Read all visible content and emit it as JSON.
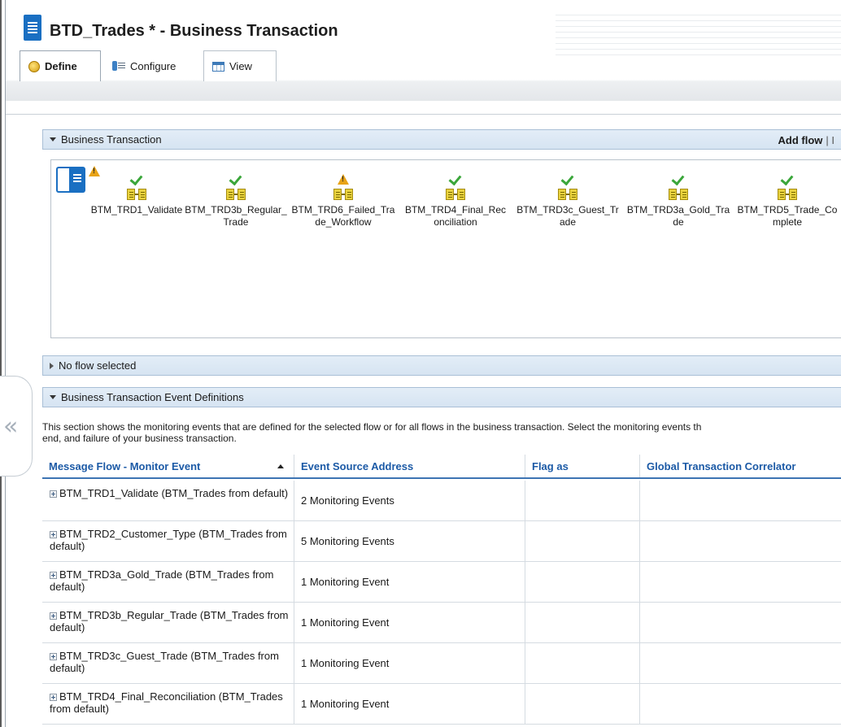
{
  "window": {
    "title": "BTD_Trades * - Business Transaction"
  },
  "tabs": [
    {
      "label": "Define",
      "icon": "define-icon",
      "active": true
    },
    {
      "label": "Configure",
      "icon": "configure-icon",
      "active": false
    },
    {
      "label": "View",
      "icon": "view-icon",
      "active": false
    }
  ],
  "business_transaction": {
    "header": "Business Transaction",
    "add_flow_label": "Add flow",
    "add_flow_separator": "| I",
    "flows": [
      {
        "name": "BTM_TRD1_Validate",
        "status": "ok"
      },
      {
        "name": "BTM_TRD3b_Regular_Trade",
        "status": "ok"
      },
      {
        "name": "BTM_TRD6_Failed_Trade_Workflow",
        "status": "warning"
      },
      {
        "name": "BTM_TRD4_Final_Reconciliation",
        "status": "ok"
      },
      {
        "name": "BTM_TRD3c_Guest_Trade",
        "status": "ok"
      },
      {
        "name": "BTM_TRD3a_Gold_Trade",
        "status": "ok"
      },
      {
        "name": "BTM_TRD5_Trade_Complete",
        "status": "ok"
      }
    ]
  },
  "no_flow": {
    "header": "No flow selected"
  },
  "event_definitions": {
    "header": "Business Transaction Event Definitions",
    "description_line1": "This section shows the monitoring events that are defined for the selected flow or for all flows in the business transaction. Select the monitoring events th",
    "description_line2": "end, and failure of your business transaction.",
    "columns": [
      "Message Flow - Monitor Event",
      "Event Source Address",
      "Flag as",
      "Global Transaction Correlator"
    ],
    "rows": [
      {
        "flow": "BTM_TRD1_Validate (BTM_Trades from default)",
        "events": "2 Monitoring Events",
        "flag": "",
        "correlator": ""
      },
      {
        "flow": "BTM_TRD2_Customer_Type (BTM_Trades from default)",
        "events": "5 Monitoring Events",
        "flag": "",
        "correlator": ""
      },
      {
        "flow": "BTM_TRD3a_Gold_Trade (BTM_Trades from default)",
        "events": "1 Monitoring Event",
        "flag": "",
        "correlator": ""
      },
      {
        "flow": "BTM_TRD3b_Regular_Trade (BTM_Trades from default)",
        "events": "1 Monitoring Event",
        "flag": "",
        "correlator": ""
      },
      {
        "flow": "BTM_TRD3c_Guest_Trade (BTM_Trades from default)",
        "events": "1 Monitoring Event",
        "flag": "",
        "correlator": ""
      },
      {
        "flow": "BTM_TRD4_Final_Reconciliation (BTM_Trades from default)",
        "events": "1 Monitoring Event",
        "flag": "",
        "correlator": ""
      }
    ]
  },
  "colors": {
    "accent": "#1c5aa6",
    "ok": "#3aa63a",
    "warning": "#e8a317",
    "section_bg": "#d6e4f2"
  }
}
